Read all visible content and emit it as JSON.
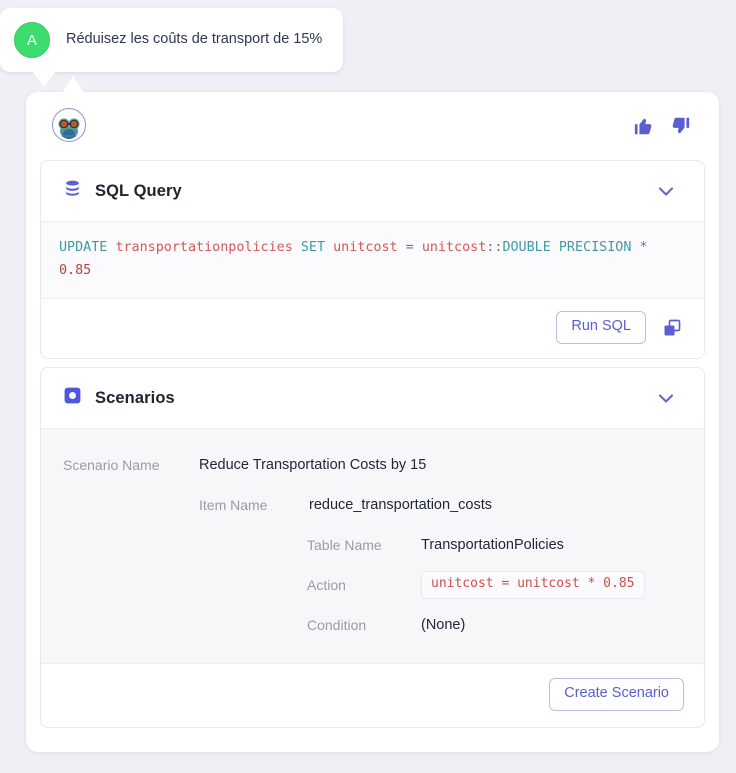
{
  "colors": {
    "page_background": "#eef0f5",
    "accent_indigo": "#5a5fd1",
    "user_avatar_green": "#3ddc6f",
    "sql_keyword": "#3f9aa6",
    "sql_identifier": "#d1595a",
    "code_red": "#cf4f4d"
  },
  "user_message": {
    "avatar_initial": "A",
    "avatar_icon": "user-avatar",
    "text": "Réduisez les coûts de transport de 15%"
  },
  "assistant": {
    "avatar_icon": "bot-avatar",
    "reactions": {
      "thumbs_up_icon": "thumbs-up-icon",
      "thumbs_down_icon": "thumbs-down-icon"
    }
  },
  "sql_panel": {
    "icon": "database-icon",
    "title": "SQL Query",
    "collapse_icon": "chevron-down-icon",
    "code_tokens": [
      {
        "t": "UPDATE",
        "c": "kw"
      },
      {
        "t": " ",
        "c": "op"
      },
      {
        "t": "transportationpolicies",
        "c": "idt"
      },
      {
        "t": " ",
        "c": "op"
      },
      {
        "t": "SET",
        "c": "kw"
      },
      {
        "t": " ",
        "c": "op"
      },
      {
        "t": "unitcost",
        "c": "idt"
      },
      {
        "t": " = ",
        "c": "op"
      },
      {
        "t": "unitcost",
        "c": "idt"
      },
      {
        "t": "::",
        "c": "op"
      },
      {
        "t": "DOUBLE PRECISION",
        "c": "kw"
      },
      {
        "t": " * ",
        "c": "op"
      },
      {
        "t": "0.85",
        "c": "num"
      }
    ],
    "code_plain": "UPDATE transportationpolicies SET unitcost = unitcost::DOUBLE PRECISION * 0.85",
    "run_button_label": "Run SQL",
    "copy_icon": "copy-icon"
  },
  "scenarios_panel": {
    "icon": "scenario-icon",
    "title": "Scenarios",
    "collapse_icon": "chevron-down-icon",
    "rows": [
      {
        "label": "Scenario Name",
        "value": "Reduce Transportation Costs by 15",
        "style": "text",
        "level": 1
      },
      {
        "label": "Item Name",
        "value": "reduce_transportation_costs",
        "style": "text",
        "level": 2
      },
      {
        "label": "Table Name",
        "value": "TransportationPolicies",
        "style": "text",
        "level": 3
      },
      {
        "label": "Action",
        "value": "unitcost = unitcost * 0.85",
        "style": "code",
        "level": 3
      },
      {
        "label": "Condition",
        "value": "(None)",
        "style": "text",
        "level": 3
      }
    ],
    "create_button_label": "Create Scenario"
  }
}
